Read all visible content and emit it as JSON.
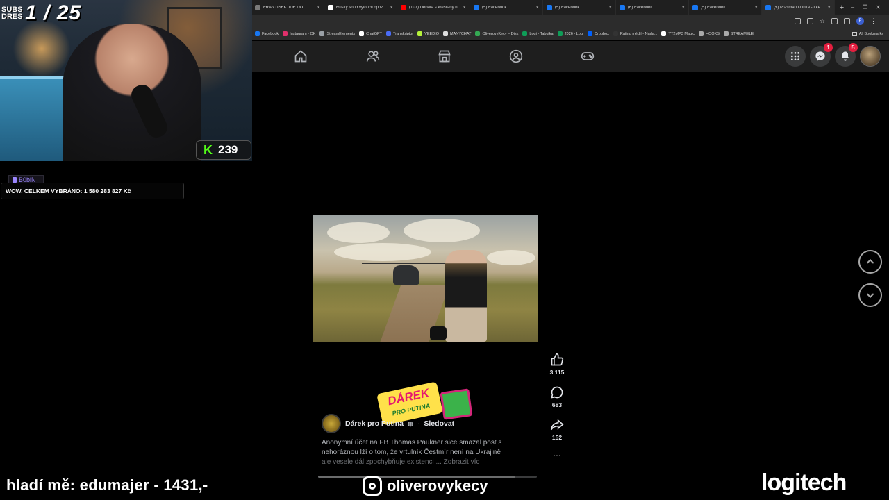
{
  "browser": {
    "tabs": [
      {
        "title": "FRANTIŠEK JDE DO",
        "favicon_color": "#7a7a7a"
      },
      {
        "title": "Ruský soud vyloučil opoz",
        "favicon_color": "#ffffff"
      },
      {
        "title": "(107) Debata s křesťany n",
        "favicon_color": "#ff0000"
      },
      {
        "title": "(5) Facebook",
        "favicon_color": "#1877f2"
      },
      {
        "title": "(5) Facebook",
        "favicon_color": "#1877f2"
      },
      {
        "title": "(6) Facebook",
        "favicon_color": "#1877f2"
      },
      {
        "title": "(5) Facebook",
        "favicon_color": "#1877f2"
      },
      {
        "title": "(5) Prasman Dunka - I ke",
        "favicon_color": "#1877f2"
      }
    ],
    "profile_initial": "P",
    "bookmarks": [
      {
        "label": "Facebook",
        "color": "#1877f2"
      },
      {
        "label": "Instagram - OK",
        "color": "#e1306c"
      },
      {
        "label": "StreamElements",
        "color": "#9aa0a6"
      },
      {
        "label": "ChatGPT",
        "color": "#ffffff"
      },
      {
        "label": "Transkriptor",
        "color": "#4a6cf7"
      },
      {
        "label": "VEEDIO",
        "color": "#b6f23b"
      },
      {
        "label": "MANYCHAT",
        "color": "#dddddd"
      },
      {
        "label": "OliverovyKecy – Disk",
        "color": "#34a853"
      },
      {
        "label": "Logi - Tabulka",
        "color": "#0f9d58"
      },
      {
        "label": "2026 - Logi",
        "color": "#0f9d58"
      },
      {
        "label": "Dropbox",
        "color": "#0061ff"
      },
      {
        "label": "Rating médií - Nada...",
        "color": "#333333"
      },
      {
        "label": "YT2MP3 Magic",
        "color": "#ffffff"
      },
      {
        "label": "HOOKS",
        "color": "#aaaaaa"
      },
      {
        "label": "STREAMELE",
        "color": "#aaaaaa"
      }
    ],
    "all_bookmarks": "All Bookmarks"
  },
  "facebook": {
    "nav_icons": [
      "home-icon",
      "friends-icon",
      "marketplace-icon",
      "groups-icon",
      "gaming-icon"
    ],
    "messenger_badge": "1",
    "notifications_badge": "5"
  },
  "stream": {
    "subs_label": "SUBS DRES",
    "subs_count": "1 / 25",
    "kick_letter": "K",
    "kick_viewers": "239",
    "donor_name": "B0biN_",
    "ticker_text": "WOW. CELKEM VYBRÁNO: 1 580 283 827 Kč",
    "thanks_text": "hladí mě: edumajer - 1431,-",
    "instagram_handle": "oliverovykecy",
    "sponsor_logo": "logitech"
  },
  "reel": {
    "likes": "3 115",
    "comments": "683",
    "shares": "152",
    "sticker_title": "DÁREK",
    "sticker_sub": "PRO PUTINA",
    "author": "Dárek pro Putina",
    "follow_label": "Sledovat",
    "caption_line1": "Anonymní účet na FB Thomas Paukner sice smazal post s",
    "caption_line2": "nehoráznou lží o tom, že vrtulník Čestmír není na Ukrajině",
    "caption_line3": "ale vesele dál zpochybňuje existenci ...",
    "see_more": "Zobrazit víc",
    "progress": 0.9
  },
  "colors": {
    "fb_badge": "#e41e3f",
    "kick_green": "#53fc18",
    "donor_purple": "#9b86ff"
  }
}
